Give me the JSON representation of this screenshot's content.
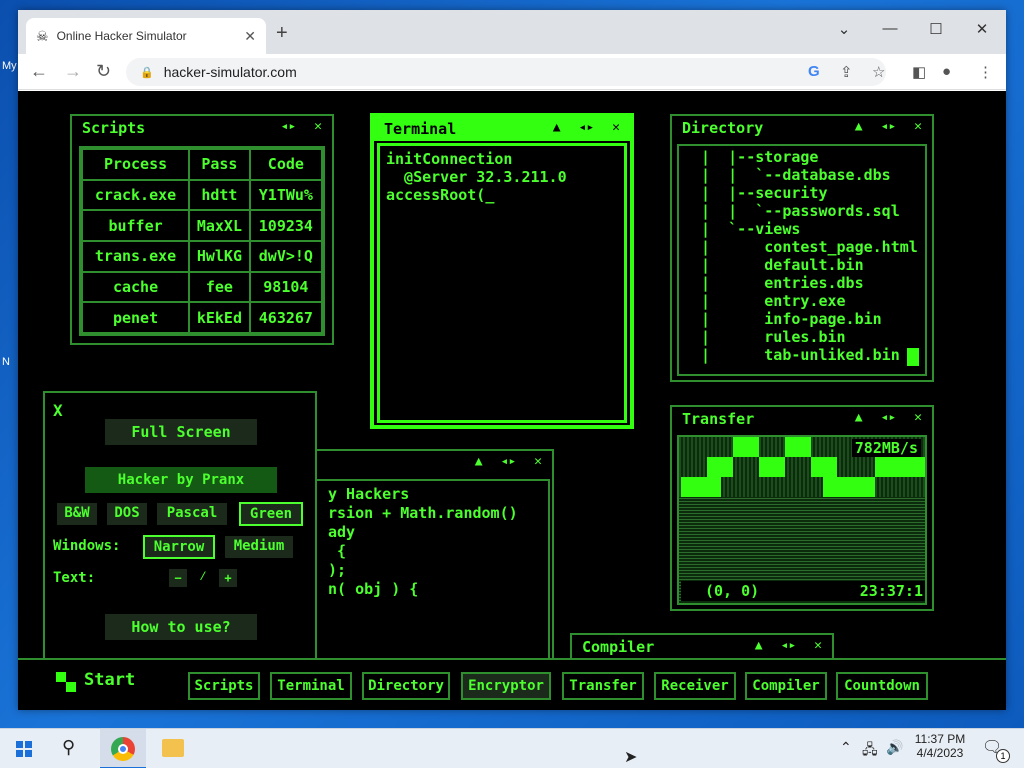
{
  "desktop": {
    "labels": [
      "My",
      "N"
    ]
  },
  "browser": {
    "tab_title": "Online Hacker Simulator",
    "url": "hacker-simulator.com",
    "minimize": "⌄",
    "new_tab": "+"
  },
  "scripts": {
    "title": "Scripts",
    "headers": [
      "Process",
      "Pass",
      "Code"
    ],
    "rows": [
      [
        "crack.exe",
        "hdtt",
        "Y1TWu%"
      ],
      [
        "buffer",
        "MaxXL",
        "109234"
      ],
      [
        "trans.exe",
        "HwlKG",
        "dwV>!Q"
      ],
      [
        "cache",
        "fee",
        "98104"
      ],
      [
        "penet",
        "kEkEd",
        "463267"
      ]
    ]
  },
  "terminal": {
    "title": "Terminal",
    "lines": [
      "initConnection",
      "  @Server 32.3.211.0",
      "accessRoot(_"
    ]
  },
  "directory": {
    "title": "Directory",
    "lines": [
      "  |  |--storage",
      "  |  |  `--database.dbs",
      "  |  |--security",
      "  |  |  `--passwords.sql",
      "  |  `--views",
      "  |      contest_page.html",
      "  |      default.bin",
      "  |      entries.dbs",
      "  |      entry.exe",
      "  |      info-page.bin",
      "  |      rules.bin",
      "  |      tab-unliked.bin"
    ]
  },
  "transfer": {
    "title": "Transfer",
    "rate": "782MB/s",
    "coords": "(0, 0)",
    "time": "23:37:1"
  },
  "encryptor": {
    "lines": [
      "y Hackers",
      "rsion + Math.random()",
      "ady",
      "",
      " {",
      ");",
      "",
      "",
      "n( obj ) {"
    ]
  },
  "compiler": {
    "title": "Compiler"
  },
  "panel": {
    "close": "X",
    "full_screen": "Full Screen",
    "credit": "Hacker by Pranx",
    "themes": [
      "B&W",
      "DOS",
      "Pascal",
      "Green"
    ],
    "windows_label": "Windows:",
    "window_sizes": [
      "Narrow",
      "Medium"
    ],
    "text_label": "Text:",
    "text_minus": "−",
    "text_slash": "⁄",
    "text_plus": "+",
    "how_to": "How to use?"
  },
  "taskbar": {
    "start": "Start",
    "buttons": [
      "Scripts",
      "Terminal",
      "Directory",
      "Encryptor",
      "Transfer",
      "Receiver",
      "Compiler",
      "Countdown"
    ]
  },
  "win": {
    "time": "11:37 PM",
    "date": "4/4/2023",
    "notif_count": "1"
  }
}
